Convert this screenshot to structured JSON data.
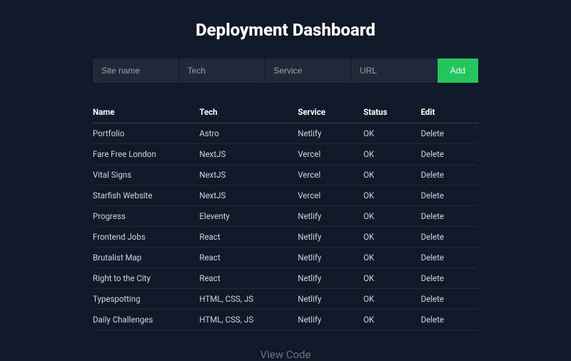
{
  "title": "Deployment Dashboard",
  "form": {
    "site_name_placeholder": "Site name",
    "tech_placeholder": "Tech",
    "service_placeholder": "Service",
    "url_placeholder": "URL",
    "add_label": "Add"
  },
  "table": {
    "headers": {
      "name": "Name",
      "tech": "Tech",
      "service": "Service",
      "status": "Status",
      "edit": "Edit"
    },
    "delete_label": "Delete",
    "rows": [
      {
        "name": "Portfolio",
        "tech": "Astro",
        "service": "Netlify",
        "status": "OK"
      },
      {
        "name": "Fare Free London",
        "tech": "NextJS",
        "service": "Vercel",
        "status": "OK"
      },
      {
        "name": "Vital Signs",
        "tech": "NextJS",
        "service": "Vercel",
        "status": "OK"
      },
      {
        "name": "Starfish Website",
        "tech": "NextJS",
        "service": "Vercel",
        "status": "OK"
      },
      {
        "name": "Progress",
        "tech": "Eleventy",
        "service": "Netlify",
        "status": "OK"
      },
      {
        "name": "Frontend Jobs",
        "tech": "React",
        "service": "Netlify",
        "status": "OK"
      },
      {
        "name": "Brutalist Map",
        "tech": "React",
        "service": "Netlify",
        "status": "OK"
      },
      {
        "name": "Right to the City",
        "tech": "React",
        "service": "Netlify",
        "status": "OK"
      },
      {
        "name": "Typespotting",
        "tech": "HTML, CSS, JS",
        "service": "Netlify",
        "status": "OK"
      },
      {
        "name": "Daily Challenges",
        "tech": "HTML, CSS, JS",
        "service": "Netlify",
        "status": "OK"
      }
    ]
  },
  "footer": {
    "view_code": "View Code"
  }
}
